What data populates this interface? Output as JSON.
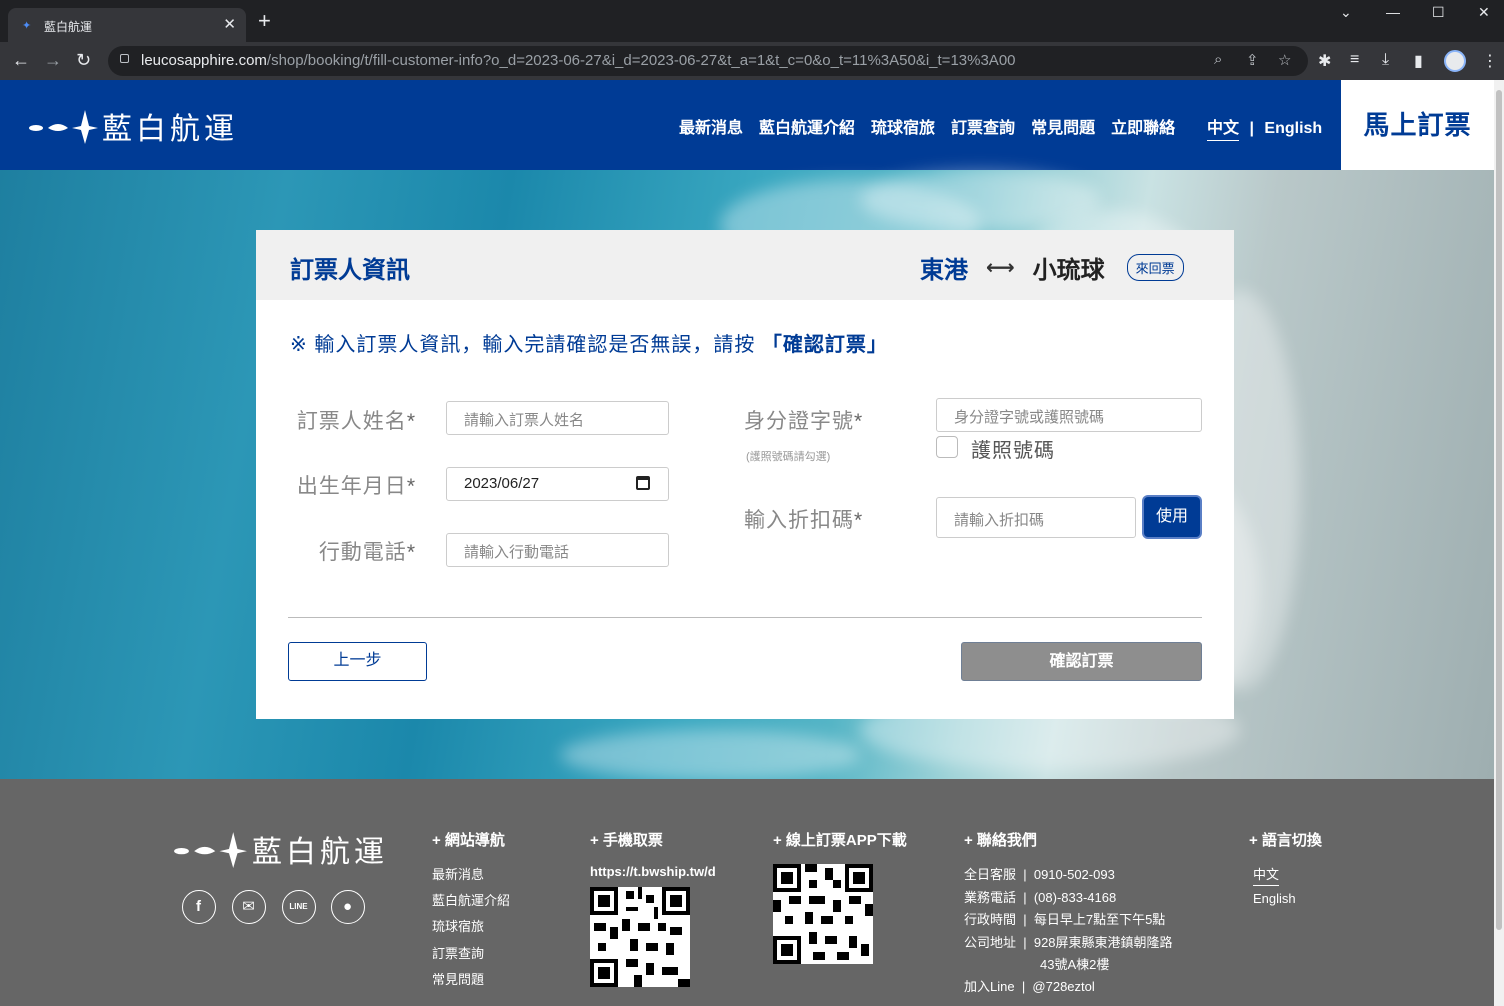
{
  "browser": {
    "tab_title": "藍白航運",
    "close_tab": "✕",
    "new_tab": "+",
    "url_domain": "leucosapphire.com",
    "url_path": "/shop/booking/t/fill-customer-info?o_d=2023-06-27&i_d=2023-06-27&t_a=1&t_c=0&o_t=11%3A50&i_t=13%3A00"
  },
  "site": {
    "logo_text": "藍白航運",
    "nav": [
      "最新消息",
      "藍白航運介紹",
      "琉球宿旅",
      "訂票查詢",
      "常見問題",
      "立即聯絡"
    ],
    "lang_zh": "中文",
    "lang_sep": "|",
    "lang_en": "English",
    "book_now": "馬上訂票",
    "brand_color": "#003b95"
  },
  "form": {
    "title": "訂票人資訊",
    "route_from": "東港",
    "route_to": "小琉球",
    "trip_type": "來回票",
    "notice": "※ 輸入訂票人資訊，輸入完請確認是否無誤，請按",
    "notice_emphasis": "「確認訂票」",
    "name_label": "訂票人姓名",
    "name_placeholder": "請輸入訂票人姓名",
    "birth_label": "出生年月日",
    "birth_value": "2023/06/27",
    "phone_label": "行動電話",
    "phone_placeholder": "請輸入行動電話",
    "id_label": "身分證字號",
    "id_sub": "(護照號碼請勾選)",
    "id_placeholder": "身分證字號或護照號碼",
    "passport_label": "護照號碼",
    "passport_checked": false,
    "discount_label": "輸入折扣碼",
    "discount_placeholder": "請輸入折扣碼",
    "use_button": "使用",
    "required_mark": "*",
    "prev_button": "上一步",
    "confirm_button": "確認訂票"
  },
  "footer": {
    "logo_text": "藍白航運",
    "social_icons": [
      "facebook-icon",
      "mail-icon",
      "line-icon",
      "chat-icon"
    ],
    "nav_heading": "+ 網站導航",
    "nav_links": [
      "最新消息",
      "藍白航運介紹",
      "琉球宿旅",
      "訂票查詢",
      "常見問題"
    ],
    "mobile_heading": "+ 手機取票",
    "mobile_url": "https://t.bwship.tw/d",
    "app_heading": "+ 線上訂票APP下載",
    "contact_heading": "+ 聯絡我們",
    "contact": [
      {
        "k": "全日客服",
        "v": "0910-502-093"
      },
      {
        "k": "業務電話",
        "v": "(08)-833-4168"
      },
      {
        "k": "行政時間",
        "v": "每日早上7點至下午5點"
      },
      {
        "k": "公司地址",
        "v": "928屏東縣東港鎮朝隆路"
      },
      {
        "k": "",
        "v": "43號A棟2樓"
      },
      {
        "k": "加入Line",
        "v": "@728eztol"
      }
    ],
    "lang_heading": "+ 語言切換",
    "lang_zh": "中文",
    "lang_en": "English"
  }
}
